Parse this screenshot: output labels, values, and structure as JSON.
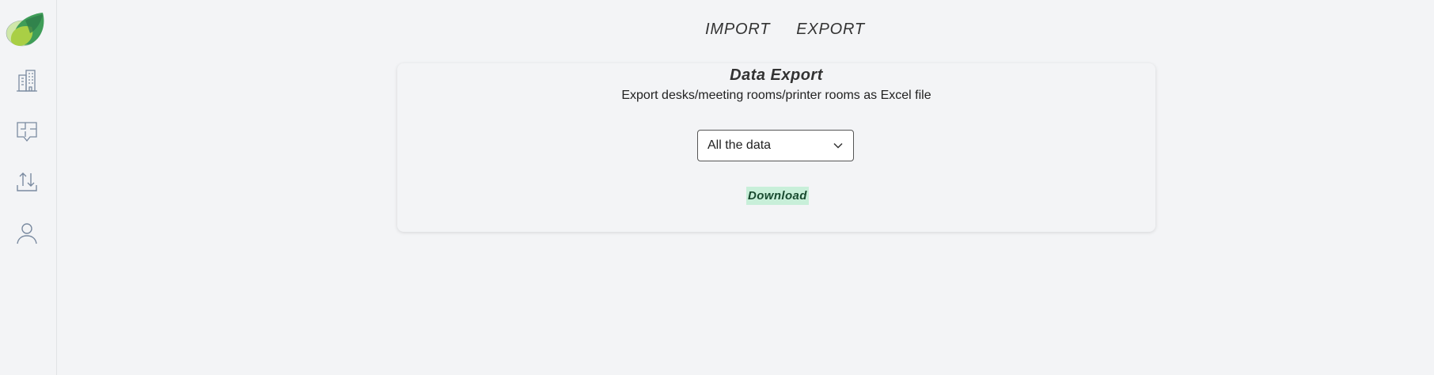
{
  "sidebar": {
    "icons": [
      "building-icon",
      "floor-plan-icon",
      "import-export-icon",
      "user-icon"
    ]
  },
  "tabs": [
    {
      "label": "IMPORT"
    },
    {
      "label": "EXPORT"
    }
  ],
  "card": {
    "title": "Data Export",
    "subtitle": "Export desks/meeting rooms/printer rooms as Excel file",
    "select_value": "All the data",
    "download_label": "Download"
  },
  "colors": {
    "background": "#f3f4f6",
    "download_bg": "#c8efd9",
    "logo_green": "#4caf50"
  }
}
